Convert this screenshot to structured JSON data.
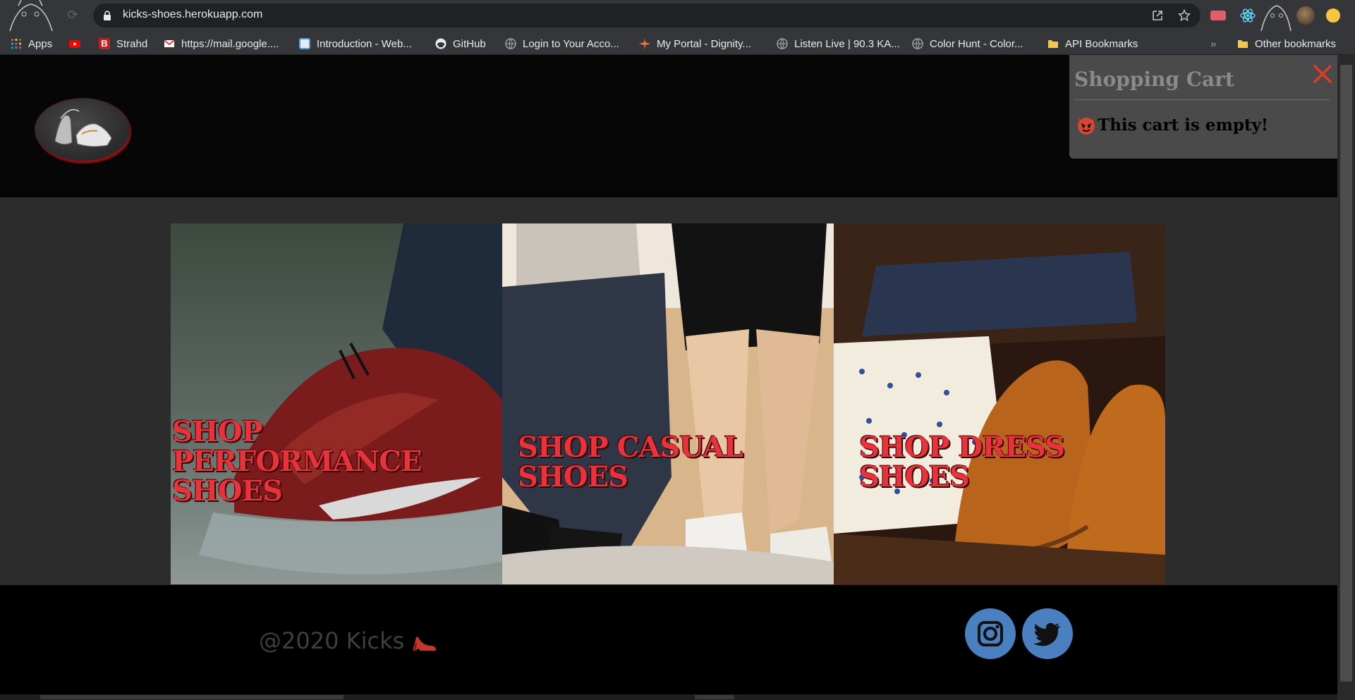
{
  "browser": {
    "url": "kicks-shoes.herokuapp.com",
    "bookmarks": [
      {
        "label": "Apps",
        "icon": "apps-grid-icon",
        "color": "#e8453c"
      },
      {
        "label": "",
        "icon": "youtube-icon",
        "color": "#ff0000"
      },
      {
        "label": "Strahd",
        "icon": "b-icon",
        "color": "#c41e1e"
      },
      {
        "label": "https://mail.google....",
        "icon": "gmail-icon",
        "color": "#ea4335"
      },
      {
        "label": "Introduction - Web...",
        "icon": "page-icon",
        "color": "#e0e0e0"
      },
      {
        "label": "GitHub",
        "icon": "github-icon",
        "color": "#e8eaed"
      },
      {
        "label": "Login to Your Acco...",
        "icon": "globe-icon",
        "color": "#9aa0a6"
      },
      {
        "label": "My Portal - Dignity...",
        "icon": "star-burst-icon",
        "color": "#e8773c"
      },
      {
        "label": "Listen Live | 90.3 KA...",
        "icon": "globe-icon",
        "color": "#9aa0a6"
      },
      {
        "label": "Color Hunt - Color...",
        "icon": "globe-icon",
        "color": "#9aa0a6"
      },
      {
        "label": "API Bookmarks",
        "icon": "folder-icon",
        "color": "#f2c94c"
      }
    ],
    "other_bookmarks": "Other bookmarks",
    "overflow": "»"
  },
  "cart": {
    "title": "Shopping Cart",
    "empty_message": "This cart is empty!"
  },
  "tiles": [
    {
      "label": "SHOP PERFORMANCE SHOES"
    },
    {
      "label": "SHOP CASUAL SHOES"
    },
    {
      "label": "SHOP DRESS SHOES"
    }
  ],
  "footer": {
    "copyright": "@2020 Kicks",
    "social": [
      "instagram-icon",
      "twitter-icon"
    ]
  },
  "colors": {
    "accent_red": "#e8323c",
    "social_blue": "#4a7fc0",
    "header_bg": "#060606",
    "body_bg": "#2c2c2c"
  }
}
